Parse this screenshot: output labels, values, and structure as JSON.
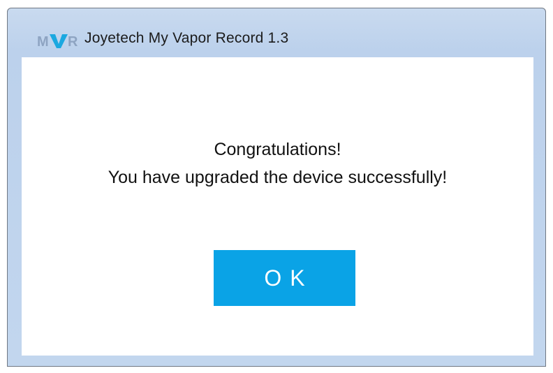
{
  "window": {
    "title": "Joyetech My Vapor Record 1.3",
    "logo": {
      "text_m": "M",
      "text_r": "R",
      "icon": "mvr-logo-icon",
      "colors": {
        "m_r": "#8ea4c2",
        "v": "#1ba8e0"
      }
    },
    "frame_color": "#bcd1ec"
  },
  "dialog": {
    "line1": "Congratulations!",
    "line2": "You have upgraded the device successfully!",
    "ok_label": "OK",
    "ok_color": "#0aa3e6"
  }
}
